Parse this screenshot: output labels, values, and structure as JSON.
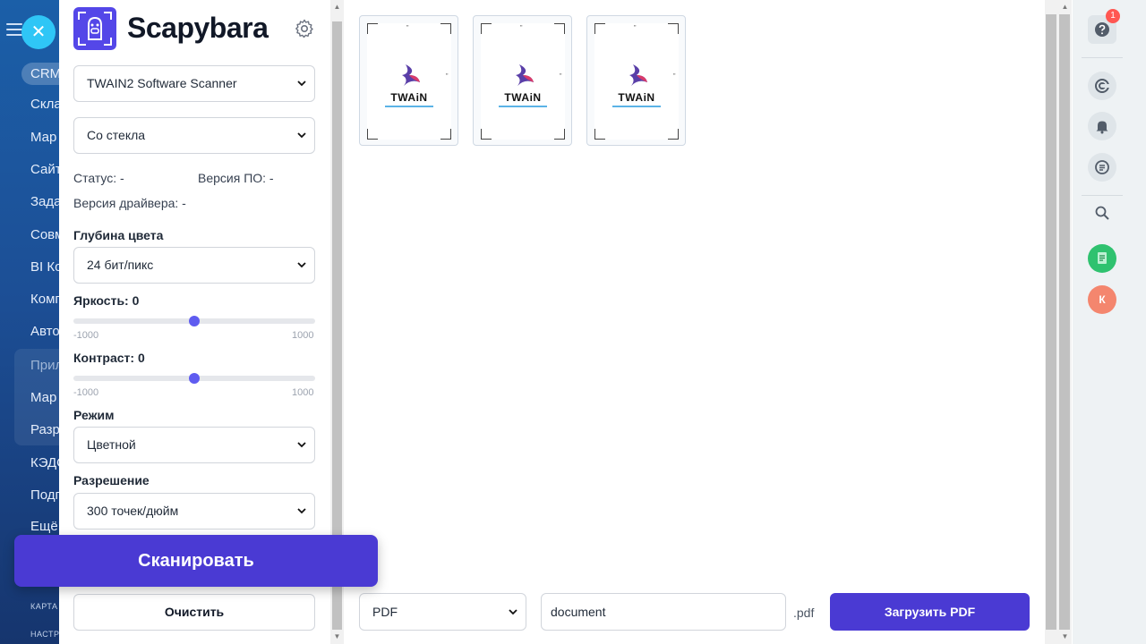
{
  "crm_nav": {
    "items": [
      {
        "label": "CRM"
      },
      {
        "label": "Скла"
      },
      {
        "label": "Мар"
      },
      {
        "label": "Сайт"
      },
      {
        "label": "Зада"
      },
      {
        "label": "Совм"
      },
      {
        "label": "BI Ко"
      },
      {
        "label": "Комп"
      },
      {
        "label": "Авто"
      },
      {
        "label": "Прил"
      },
      {
        "label": "Мар"
      },
      {
        "label": "Разр"
      },
      {
        "label": "КЭДО"
      },
      {
        "label": "Подп"
      },
      {
        "label": "Ещё"
      }
    ],
    "footer": [
      "КАРТА",
      "НАСТР"
    ],
    "close_glyph": "✕"
  },
  "scanner": {
    "brand": "Scapybara",
    "scanner_select": "TWAIN2 Software Scanner",
    "source_select": "Со стекла",
    "status_label": "Статус: -",
    "firmware_label": "Версия ПО: -",
    "driver_label": "Версия драйвера: -",
    "color_depth": {
      "label": "Глубина цвета",
      "value": "24 бит/пикс"
    },
    "brightness": {
      "label": "Яркость: 0",
      "min": "-1000",
      "max": "1000",
      "value": 0
    },
    "contrast": {
      "label": "Контраст: 0",
      "min": "-1000",
      "max": "1000",
      "value": 0
    },
    "mode": {
      "label": "Режим",
      "value": "Цветной"
    },
    "resolution": {
      "label": "Разрешение",
      "value": "300 точек/дюйм"
    },
    "scan_button": "Сканировать",
    "clear_button": "Очистить"
  },
  "preview": {
    "pages": [
      {
        "logo_text": "TWAiN"
      },
      {
        "logo_text": "TWAiN"
      },
      {
        "logo_text": "TWAiN"
      }
    ],
    "quote_mark": "\""
  },
  "export": {
    "format": "PDF",
    "filename": "document",
    "extension": ".pdf",
    "upload_button": "Загрузить PDF"
  },
  "rail": {
    "help_badge": "1",
    "avatar_initial": "К"
  },
  "colors": {
    "accent": "#4a3ad3",
    "logo_bg": "#5447e8",
    "slider_thumb": "#5f5cf0",
    "crm_close": "#2fc6f6",
    "badge": "#ff5752",
    "avatar": "#f4866e"
  }
}
